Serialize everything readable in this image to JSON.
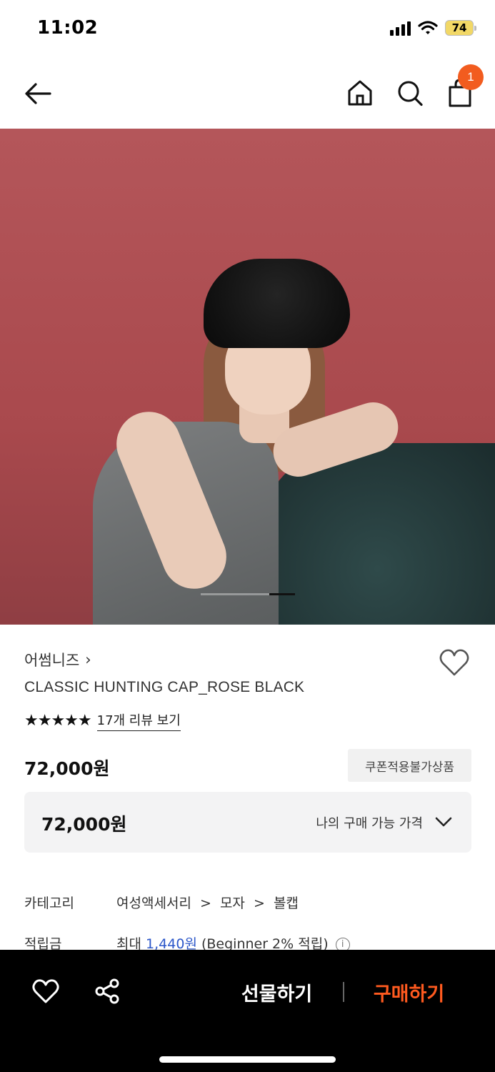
{
  "status_bar": {
    "time": "11:02",
    "battery": "74"
  },
  "header": {
    "cart_count": "1"
  },
  "product": {
    "brand": "어썸니즈",
    "brand_chevron": "›",
    "title": "CLASSIC HUNTING CAP_ROSE BLACK",
    "rating_stars": "★★★★★",
    "review_link": "17개 리뷰 보기",
    "price": "72,000원",
    "coupon_badge": "쿠폰적용불가상품",
    "my_price_value": "72,000원",
    "my_price_label": "나의 구매 가능 가격"
  },
  "details": {
    "category_label": "카테고리",
    "category_path": [
      "여성액세서리",
      "모자",
      "볼캡"
    ],
    "separator": ">",
    "points_label": "적립금",
    "points_prefix": "최대 ",
    "points_value": "1,440원",
    "points_suffix": " (Beginner 2% 적립)",
    "info_glyph": "i"
  },
  "bottom_bar": {
    "gift_label": "선물하기",
    "buy_label": "구매하기"
  },
  "colors": {
    "accent": "#f25c1f",
    "buy": "#ff5a1f",
    "link_blue": "#2c57c9",
    "bottom_bar": "#000000"
  },
  "icons": [
    "back-arrow-icon",
    "home-icon",
    "search-icon",
    "cart-icon",
    "heart-icon",
    "share-icon",
    "chevron-down-icon",
    "info-icon"
  ]
}
